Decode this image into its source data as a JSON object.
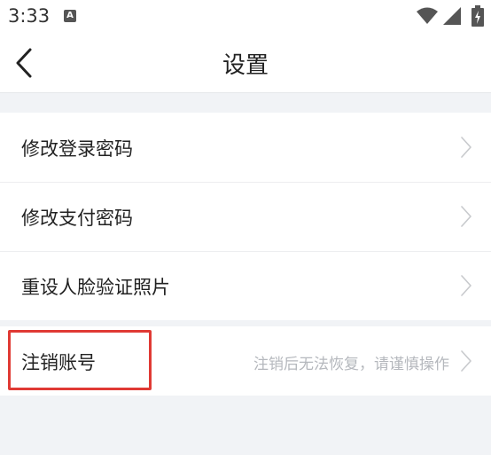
{
  "status_bar": {
    "time": "3:33",
    "app_icon": "A",
    "icons": [
      "wifi-icon",
      "signal-icon",
      "battery-icon"
    ]
  },
  "header": {
    "title": "设置",
    "back_icon": "chevron-left-icon"
  },
  "settings": {
    "items": [
      {
        "label": "修改登录密码",
        "hint": ""
      },
      {
        "label": "修改支付密码",
        "hint": ""
      },
      {
        "label": "重设人脸验证照片",
        "hint": ""
      }
    ],
    "cancel_account": {
      "label": "注销账号",
      "hint": "注销后无法恢复，请谨慎操作"
    }
  },
  "colors": {
    "background": "#f1f3f6",
    "highlight": "#e03a34",
    "hint_text": "#b5b8bd"
  }
}
